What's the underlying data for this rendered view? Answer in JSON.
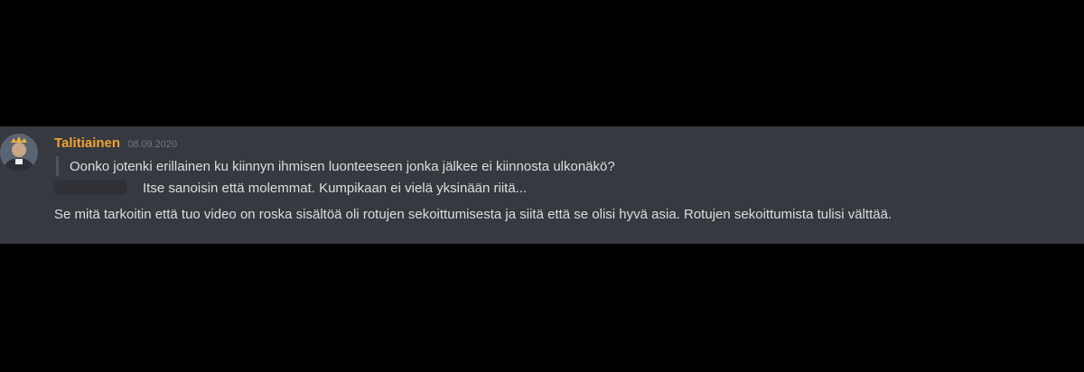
{
  "message": {
    "author": "Talitiainen",
    "timestamp": "08.09.2020",
    "quote": "Oonko jotenki erillainen ku kiinnyn ihmisen luonteeseen jonka jälkee ei kiinnosta ulkonäkö?",
    "reply": "Itse sanoisin että molemmat. Kumpikaan ei vielä yksinään riitä...",
    "body": "Se mitä tarkoitin että tuo video on roska sisältöä oli rotujen sekoittumisesta ja siitä että se olisi hyvä asia. Rotujen sekoittumista tulisi välttää."
  },
  "colors": {
    "page_background": "#000000",
    "panel_background": "#36393f",
    "author_color": "#f0a232",
    "text_color": "#dcddde",
    "timestamp_color": "#72767d"
  }
}
